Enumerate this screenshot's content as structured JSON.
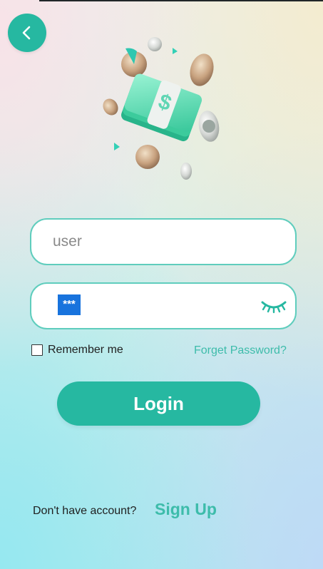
{
  "colors": {
    "accent": "#26b8a1",
    "link": "#3dbcaa",
    "field_border": "#5fcdbd",
    "mask_highlight": "#1873dd"
  },
  "header": {
    "back_icon": "chevron-left-icon"
  },
  "hero": {
    "icon": "money-coins-illustration"
  },
  "login_form": {
    "username": {
      "value": "",
      "placeholder": "user"
    },
    "password": {
      "masked_value": "***",
      "toggle_icon": "eye-closed-icon"
    },
    "remember_me": {
      "label": "Remember me",
      "checked": false
    },
    "forgot_password_label": "Forget Password?",
    "login_button_label": "Login"
  },
  "footer": {
    "no_account_text": "Don't have account?",
    "sign_up_label": "Sign Up"
  }
}
